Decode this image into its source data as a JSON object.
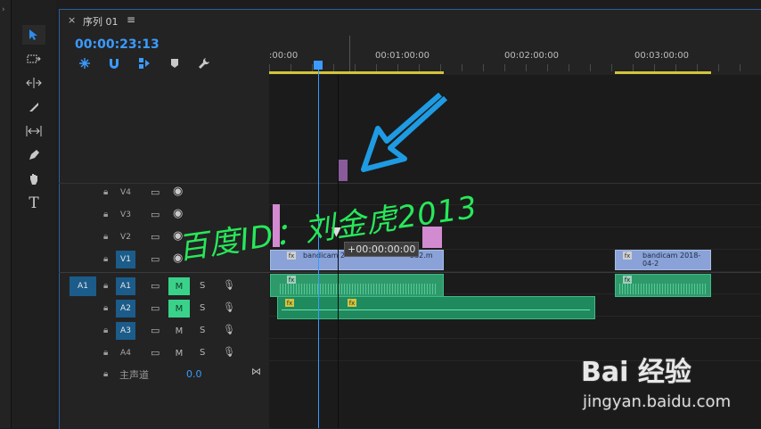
{
  "tab": {
    "close": "×",
    "title": "序列 01",
    "menu": "≡"
  },
  "timecode": "00:00:23:13",
  "ruler": {
    "ticks": [
      ":00:00",
      "00:01:00:00",
      "00:02:00:00",
      "00:03:00:00"
    ]
  },
  "tracks": {
    "video": [
      {
        "name": "V4",
        "active": false
      },
      {
        "name": "V3",
        "active": false
      },
      {
        "name": "V2",
        "active": false
      },
      {
        "name": "V1",
        "active": true
      }
    ],
    "audio": [
      {
        "name": "A1",
        "m": "M",
        "s": "S",
        "m_on": true
      },
      {
        "name": "A2",
        "m": "M",
        "s": "S",
        "m_on": true
      },
      {
        "name": "A3",
        "m": "M",
        "s": "S",
        "m_on": false
      },
      {
        "name": "A4",
        "m": "M",
        "s": "S",
        "m_on": false
      }
    ],
    "source_patch": "A1",
    "master": {
      "label": "主声道",
      "value": "0.0"
    }
  },
  "clips": {
    "v1_a_label": "bandicam 2",
    "v1_a_label2": "532.m",
    "v1_b_label": "bandicam 2018-04-2",
    "tooltip": "+00:00:00:00",
    "fx": "fx"
  },
  "watermark_text": "百度ID：刘金虎2013",
  "logo": {
    "brand": "Bai 经验",
    "url": "jingyan.baidu.com"
  },
  "colors": {
    "accent": "#3b9bff",
    "workbar": "#d2c43b",
    "video_clip": "#8aa2d8",
    "audio_clip": "#2e9a6c",
    "watermark_green": "#27e85a",
    "watermark_pink": "#ee2fd3",
    "arrow": "#1e9be3"
  }
}
